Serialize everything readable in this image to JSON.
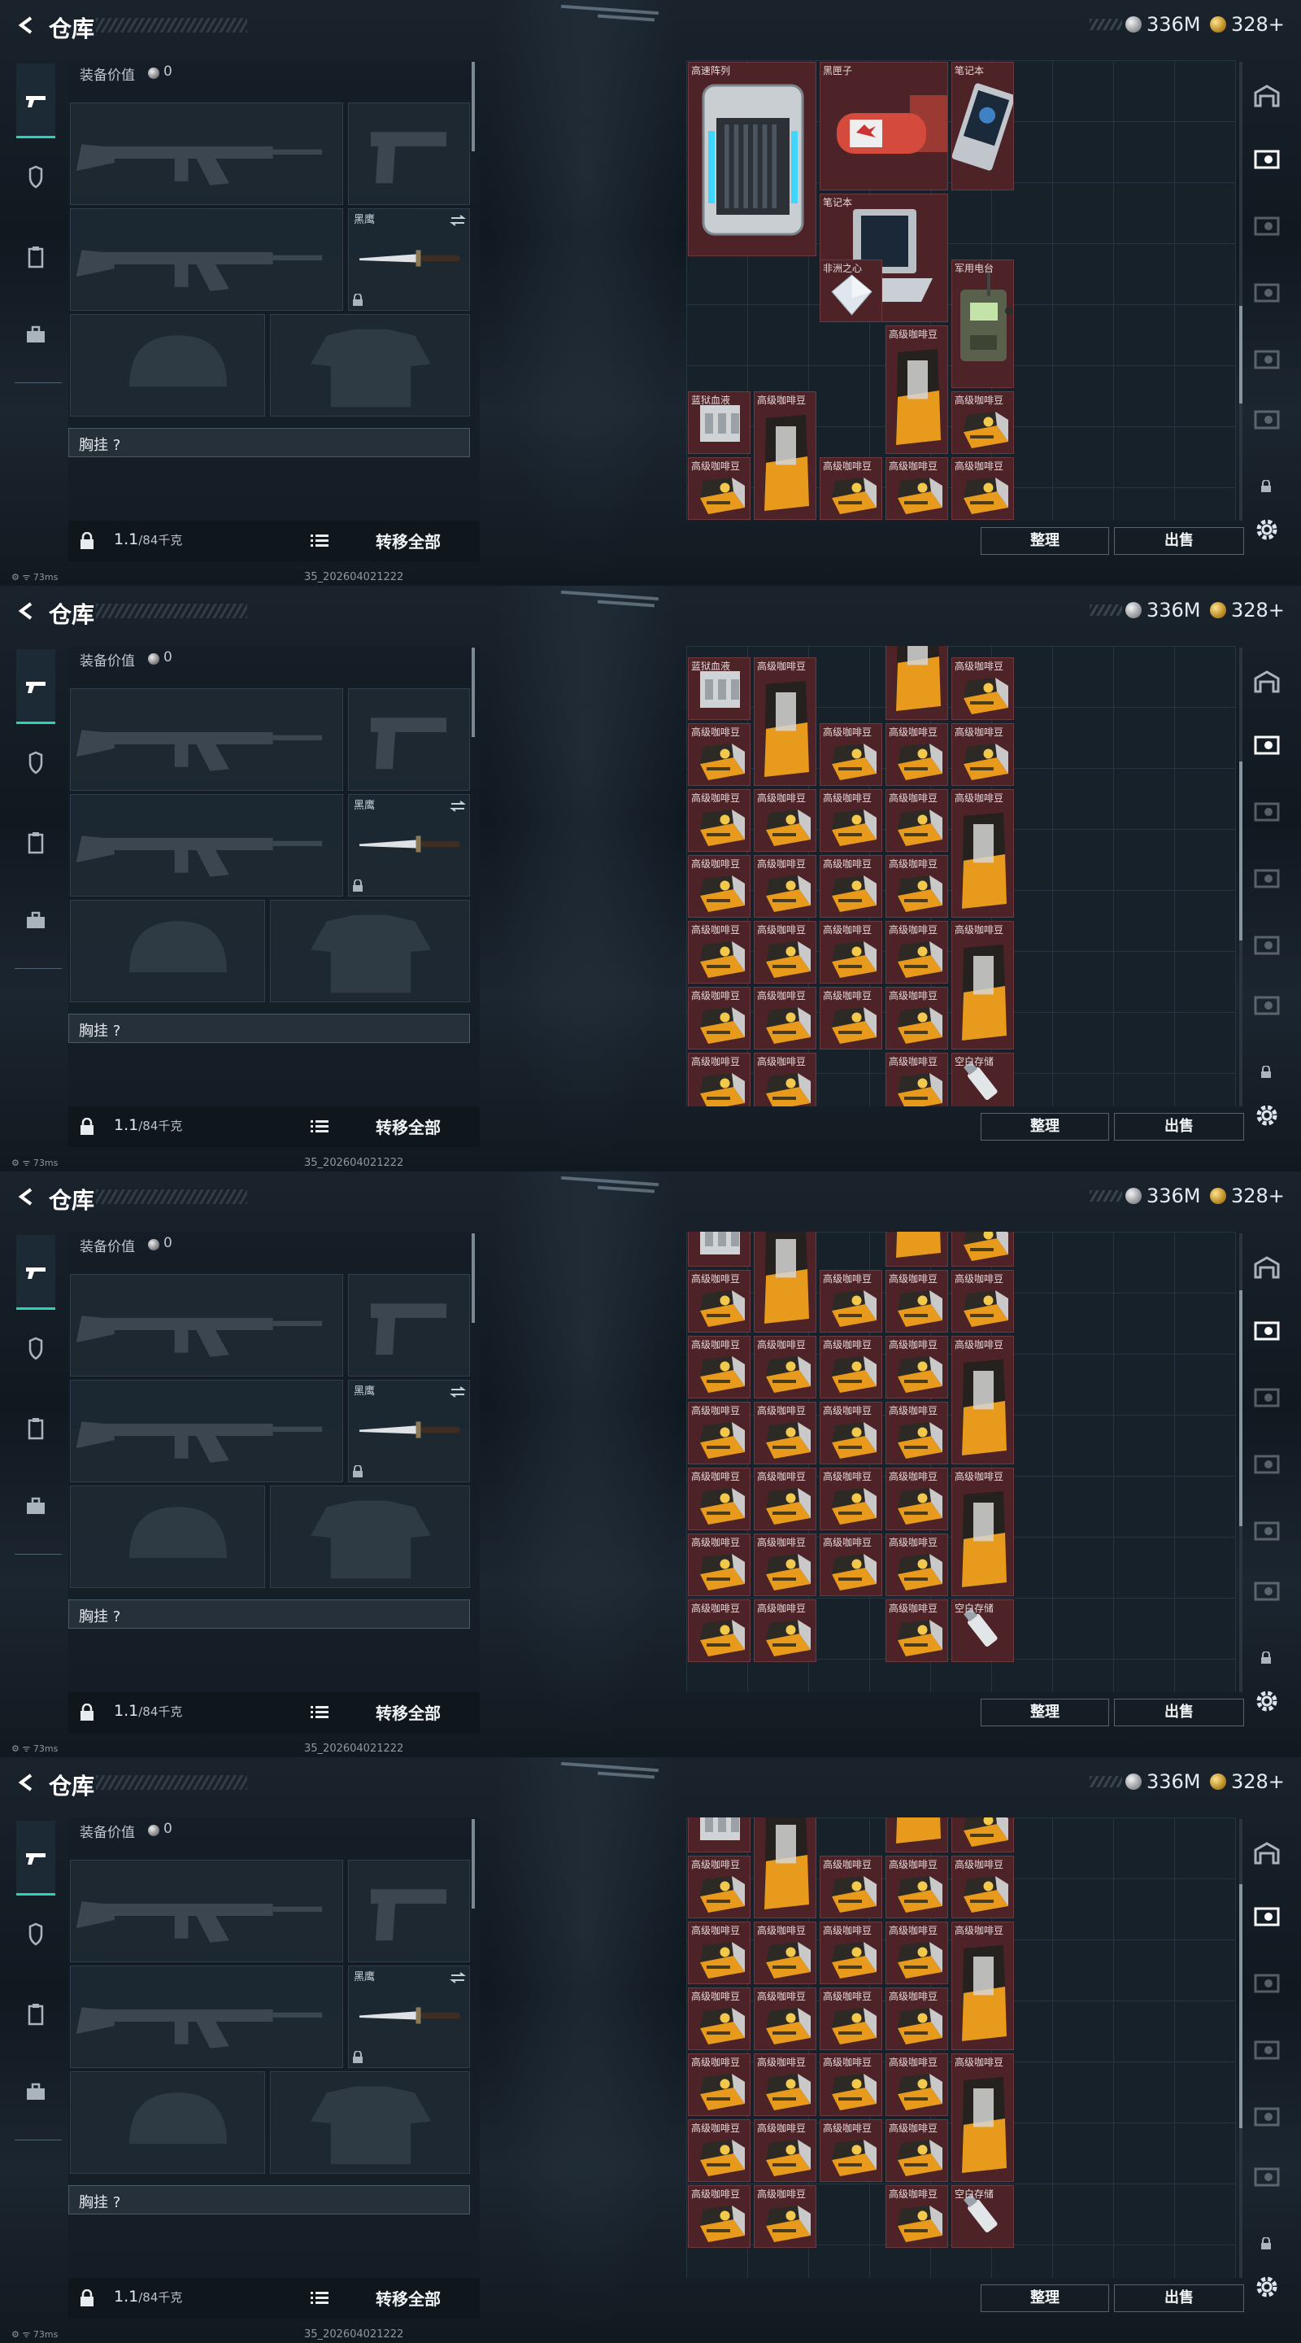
{
  "header": {
    "title": "仓库",
    "currency_silver": "336M",
    "currency_gold": "328+"
  },
  "loadout": {
    "value_label": "装备价值",
    "value": "0",
    "knife_name": "黑鹰",
    "chest_label": "胸挂 ?",
    "weight_value": "1.1",
    "weight_max": "/84千克",
    "transfer_all": "转移全部"
  },
  "actions": {
    "sort": "整理",
    "sell": "出售"
  },
  "status": {
    "ping": "73ms",
    "build": "35_202604021222"
  },
  "items": {
    "raid_array": "高速阵列",
    "black_box": "黑匣子",
    "laptop": "笔记本",
    "gem": "非洲之心",
    "radio": "军用电台",
    "coffee": "高级咖啡豆",
    "blue_sample": "蓝狱血液",
    "drive": "空白存储"
  },
  "colors": {
    "item_bg": "#4d2327",
    "accent": "#2fd2b0",
    "coffee_orange": "#e89a1c"
  }
}
